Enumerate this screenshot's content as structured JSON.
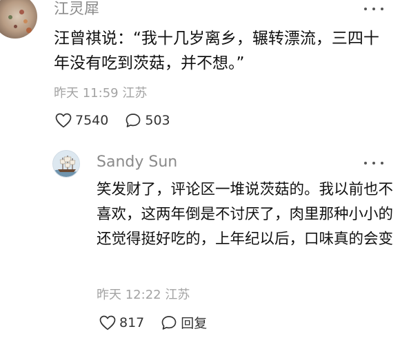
{
  "comment1": {
    "username": "江灵犀",
    "text": "汪曾祺说：“我十几岁离乡，辗转漂流，三四十年没有吃到茨菇，并不想。”",
    "time": "昨天 11:59",
    "location": "江苏",
    "likes": "7540",
    "replies": "503",
    "avatar_icon": "user-avatar-floral"
  },
  "comment2": {
    "username": "Sandy Sun",
    "text": "笑发财了，评论区一堆说茨菇的。我以前也不喜欢，这两年倒是不讨厌了，肉里那种小小的还觉得挺好吃的，上年纪以后，口味真的会变",
    "time": "昨天 12:22",
    "location": "江苏",
    "likes": "817",
    "reply_label": "回复",
    "avatar_icon": "user-avatar-sailing-ship"
  },
  "colors": {
    "name": "#8a8a8a",
    "meta": "#a3a3a3",
    "body": "#111111"
  }
}
